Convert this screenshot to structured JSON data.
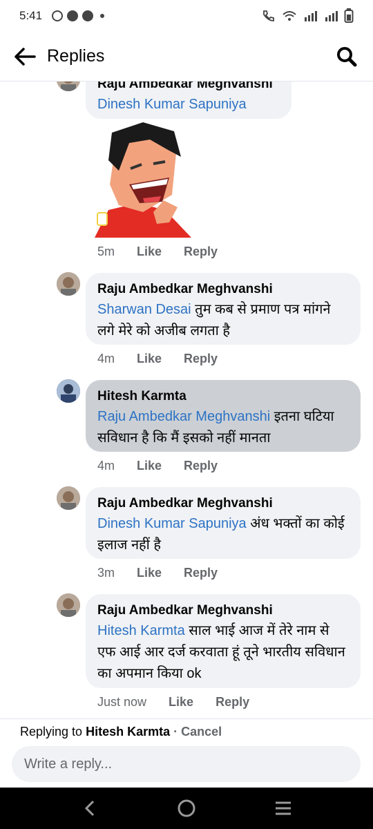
{
  "status_bar": {
    "time": "5:41"
  },
  "app_bar": {
    "title": "Replies"
  },
  "comments": [
    {
      "author": "Raju Ambedkar Meghvanshi",
      "mention": "Dinesh Kumar Sapuniya",
      "text": "",
      "time": "5m",
      "sticker": "laughing-man-sticker"
    },
    {
      "author": "Raju Ambedkar Meghvanshi",
      "mention": "Sharwan Desai",
      "text": " तुम कब से प्रमाण पत्र मांगने लगे मेरे को अजीब लगता है",
      "time": "4m"
    },
    {
      "author": "Hitesh Karmta",
      "mention": "Raju Ambedkar Meghvanshi",
      "text": " इतना घटिया सविधान है कि मैं इसको नहीं मानता",
      "time": "4m"
    },
    {
      "author": "Raju Ambedkar Meghvanshi",
      "mention": "Dinesh Kumar Sapuniya",
      "text": " अंध भक्तों का कोई इलाज नहीं है",
      "time": "3m"
    },
    {
      "author": "Raju Ambedkar Meghvanshi",
      "mention": "Hitesh Karmta",
      "text": " साल भाई आज में तेरे नाम से एफ आई आर दर्ज करवाता हूं तूने भारतीय सविधान का अपमान किया ok",
      "time": "Just now"
    }
  ],
  "actions": {
    "like": "Like",
    "reply": "Reply"
  },
  "reply_bar": {
    "prefix": "Replying to",
    "target": "Hitesh Karmta",
    "separator": " · ",
    "cancel": "Cancel",
    "placeholder": "Write a reply..."
  },
  "colors": {
    "mention": "#2d72c4",
    "bubble": "#f0f2f5",
    "bubble_highlight": "#ccd0d5"
  }
}
